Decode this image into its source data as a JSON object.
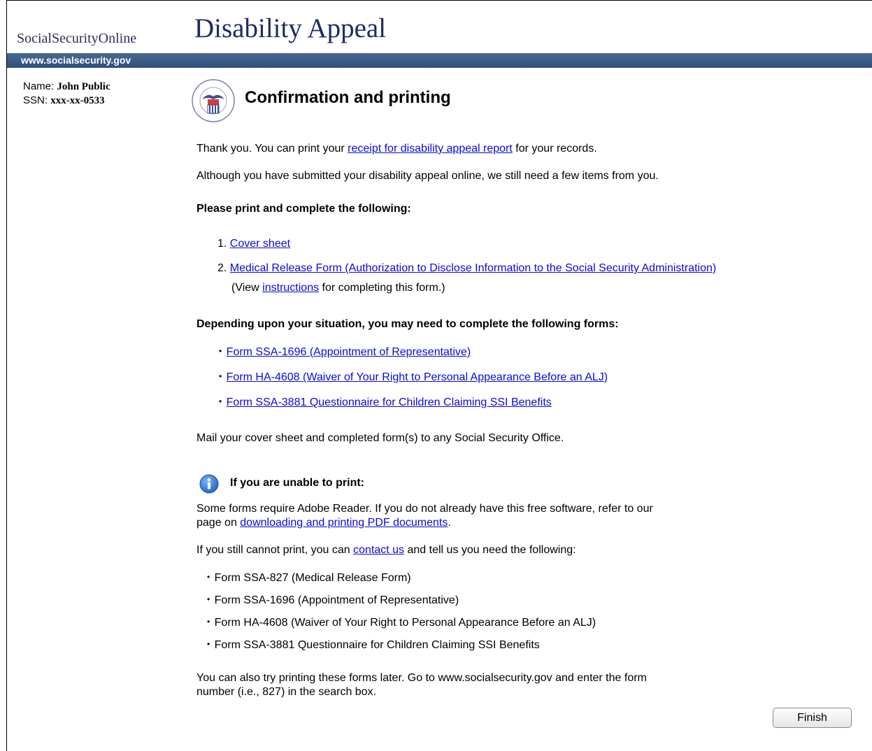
{
  "header": {
    "site_name": "SocialSecurityOnline",
    "page_title": "Disability Appeal",
    "url": "www.socialsecurity.gov"
  },
  "user": {
    "name_label": "Name:",
    "name": "John Public",
    "ssn_label": "SSN:",
    "ssn": "xxx-xx-0533"
  },
  "main": {
    "title": "Confirmation and printing",
    "thanks_prefix": "Thank you. You can print your ",
    "receipt_link": "receipt for disability appeal report",
    "thanks_suffix": " for your records.",
    "although_text": "Although you have submitted your disability appeal online, we still need a few items from you.",
    "print_heading": "Please print and complete the following:",
    "required_items": [
      {
        "num": "1.",
        "label": "Cover sheet"
      },
      {
        "num": "2.",
        "label": "Medical Release Form (Authorization to Disclose Information to the Social Security Administration)"
      }
    ],
    "instructions_prefix": "(View ",
    "instructions_link": "instructions",
    "instructions_suffix": " for completing this form.)",
    "optional_heading": "Depending upon your situation, you may need to complete the following forms:",
    "optional_forms": [
      "Form SSA-1696 (Appointment of Representative)",
      "Form HA-4608 (Waiver of Your Right to Personal Appearance Before an ALJ)",
      "Form SSA-3881 Questionnaire for Children Claiming SSI Benefits"
    ],
    "mail_text": "Mail your cover sheet and completed form(s) to any Social Security Office.",
    "unable_heading": "If you are unable to print:",
    "adobe_line1": "Some forms require Adobe Reader. If you do not already have this free software, refer to our",
    "adobe_line2_prefix": "page on ",
    "pdf_link": "downloading and printing PDF documents",
    "adobe_line2_suffix": ".",
    "contact_prefix": "If you still cannot print, you can ",
    "contact_link": "contact us",
    "contact_suffix": " and tell us you need the following:",
    "needed_forms": [
      "Form SSA-827 (Medical Release Form)",
      "Form SSA-1696 (Appointment of Representative)",
      "Form HA-4608 (Waiver of Your Right to Personal Appearance Before an ALJ)",
      "Form SSA-3881 Questionnaire for Children Claiming SSI Benefits"
    ],
    "later_line1": "You can also try printing these forms later. Go to www.socialsecurity.gov and enter the form",
    "later_line2": "number (i.e., 827) in the search box.",
    "bullet": "•"
  },
  "footer": {
    "finish_label": "Finish"
  },
  "colors": {
    "link": "#0a0ad6",
    "header_bar": "#3a5a86",
    "title_text": "#1f2a66",
    "info_icon": "#2f7fd8"
  },
  "icons": {
    "seal": "ssa-seal-icon",
    "info": "info-icon"
  }
}
